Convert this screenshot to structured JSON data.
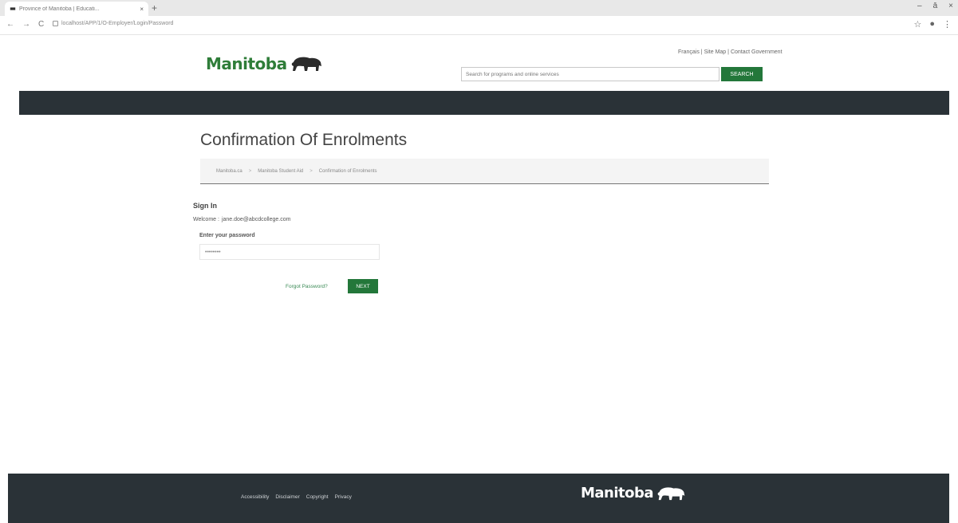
{
  "browser": {
    "tab_title": "Province of Manitoba | Educati...",
    "tab_close": "×",
    "new_tab": "+",
    "url": "localhost/APP/1/O-Employer/Login/Password",
    "window_controls": {
      "minimize": "–",
      "restore": "ā",
      "close": "×"
    }
  },
  "header": {
    "logo_text": "Manitoba",
    "links": {
      "francais": "Français",
      "site_map": "Site Map",
      "contact": "Contact Government",
      "separator": "|"
    },
    "search": {
      "placeholder": "Search for programs and online services",
      "button_label": "SEARCH"
    }
  },
  "main": {
    "page_title": "Confirmation Of Enrolments",
    "breadcrumb": [
      "Manitoba.ca",
      "Manitoba Student Aid",
      "Confirmation of Enrolments"
    ],
    "breadcrumb_separator": ">",
    "signin": {
      "heading": "Sign In",
      "welcome_label": "Welcome :",
      "email": "jane.doe@abcdcollege.com",
      "password_label": "Enter your password",
      "password_value": "••••••••",
      "forgot_link": "Forgot Password?",
      "next_button": "NEXT"
    }
  },
  "footer": {
    "links": [
      "Accessibility",
      "Disclaimer",
      "Copyright",
      "Privacy"
    ],
    "logo_text": "Manitoba"
  },
  "colors": {
    "brand_green": "#2f7d39",
    "button_green": "#23773a",
    "nav_dark": "#2a3237"
  }
}
